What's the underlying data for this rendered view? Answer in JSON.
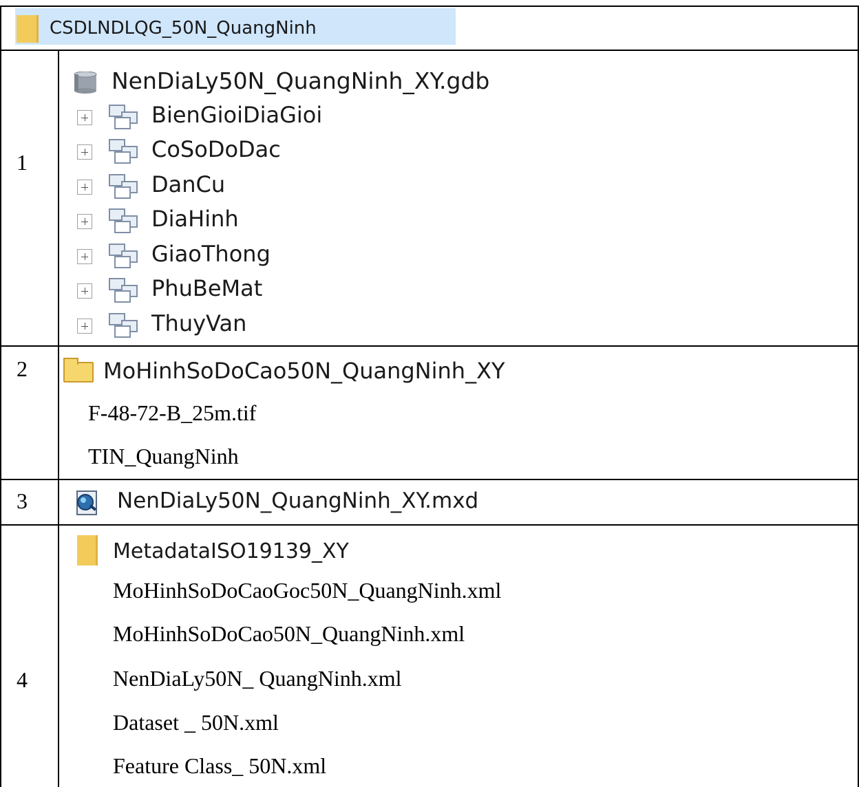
{
  "root": {
    "label": "CSDLNDLQG_50N_QuangNinh"
  },
  "rows": [
    {
      "number": "1"
    },
    {
      "number": "2"
    },
    {
      "number": "3"
    },
    {
      "number": "4"
    }
  ],
  "row1": {
    "gdb_label": "NenDiaLy50N_QuangNinh_XY.gdb",
    "datasets": [
      "BienGioiDiaGioi",
      "CoSoDoDac",
      "DanCu",
      "DiaHinh",
      "GiaoThong",
      "PhuBeMat",
      "ThuyVan"
    ]
  },
  "row2": {
    "folder_label": "MoHinhSoDoCao50N_QuangNinh_XY",
    "files": [
      "F-48-72-B_25m.tif",
      "TIN_QuangNinh"
    ]
  },
  "row3": {
    "mxd_label": "NenDiaLy50N_QuangNinh_XY.mxd"
  },
  "row4": {
    "folder_label": "MetadataISO19139_XY",
    "files": [
      "MoHinhSoDoCaoGoc50N_QuangNinh.xml",
      "MoHinhSoDoCao50N_QuangNinh.xml",
      "NenDiaLy50N_ QuangNinh.xml",
      "Dataset _ 50N.xml",
      "Feature Class_ 50N.xml"
    ]
  },
  "icons": {
    "root": "folder-icon",
    "gdb": "database-icon",
    "dataset": "feature-dataset-icon",
    "expand": "plus-expand-icon",
    "row2_folder": "folder-icon",
    "mxd": "arcmap-document-icon",
    "row4_folder": "folder-icon"
  }
}
